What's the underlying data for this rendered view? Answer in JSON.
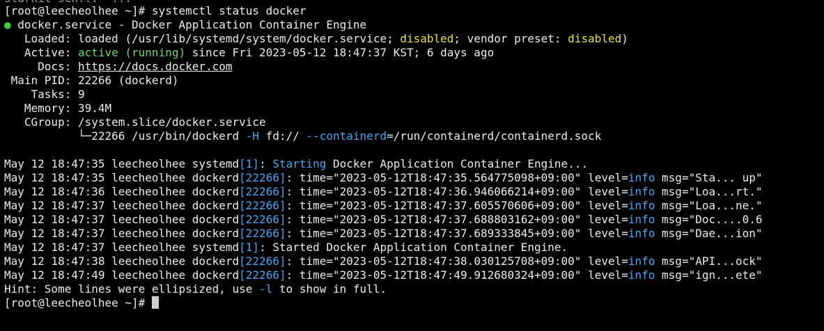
{
  "top_partial": "slarkit-sch...  ...",
  "prompt": "[root@leecheolhee ~]# ",
  "command": "systemctl status docker",
  "service": {
    "dot": "●",
    "name_line": " docker.service - Docker Application Container Engine",
    "loaded_label": "   Loaded: ",
    "loaded_value": "loaded (/usr/lib/systemd/system/docker.service; ",
    "loaded_disabled": "disabled",
    "loaded_mid": "; vendor preset: ",
    "loaded_preset": "disabled",
    "loaded_end": ")",
    "active_label": "   Active: ",
    "active_state": "active (running)",
    "active_since": " since Fri 2023-05-12 18:47:37 KST; 6 days ago",
    "docs_label": "     Docs: ",
    "docs_url": "https://docs.docker.com",
    "pid_line": " Main PID: 22266 (dockerd)",
    "tasks_line": "    Tasks: 9",
    "memory_line": "   Memory: 39.4M",
    "cgroup_line": "   CGroup: /system.slice/docker.service",
    "cgroup_tree_prefix": "           └─22266 /usr/bin/dockerd ",
    "cgroup_flag_h": "-H",
    "cgroup_mid": " fd:// ",
    "cgroup_flag_containerd": "--containerd",
    "cgroup_end": "=/run/containerd/containerd.sock"
  },
  "logs": [
    {
      "prefix": "May 12 18:47:35 leecheolhee systemd",
      "pid": "[1]",
      "sep": ": ",
      "mode": "start",
      "text_blue": "Starting",
      "text_rest": " Docker Application Container Engine..."
    },
    {
      "prefix": "May 12 18:47:35 leecheolhee dockerd",
      "pid": "[22266]",
      "sep": ": ",
      "mode": "dockerd",
      "time": "time=\"2023-05-12T18:47:35.564775098+09:00\" ",
      "level_key": "level=",
      "level_val": "info",
      "msg": " msg=\"Sta... up\""
    },
    {
      "prefix": "May 12 18:47:36 leecheolhee dockerd",
      "pid": "[22266]",
      "sep": ": ",
      "mode": "dockerd",
      "time": "time=\"2023-05-12T18:47:36.946066214+09:00\" ",
      "level_key": "level=",
      "level_val": "info",
      "msg": " msg=\"Loa...rt.\""
    },
    {
      "prefix": "May 12 18:47:37 leecheolhee dockerd",
      "pid": "[22266]",
      "sep": ": ",
      "mode": "dockerd",
      "time": "time=\"2023-05-12T18:47:37.605570606+09:00\" ",
      "level_key": "level=",
      "level_val": "info",
      "msg": " msg=\"Loa...ne.\""
    },
    {
      "prefix": "May 12 18:47:37 leecheolhee dockerd",
      "pid": "[22266]",
      "sep": ": ",
      "mode": "dockerd",
      "time": "time=\"2023-05-12T18:47:37.688803162+09:00\" ",
      "level_key": "level=",
      "level_val": "info",
      "msg": " msg=\"Doc....0.6"
    },
    {
      "prefix": "May 12 18:47:37 leecheolhee dockerd",
      "pid": "[22266]",
      "sep": ": ",
      "mode": "dockerd",
      "time": "time=\"2023-05-12T18:47:37.689333845+09:00\" ",
      "level_key": "level=",
      "level_val": "info",
      "msg": " msg=\"Dae...ion\""
    },
    {
      "prefix": "May 12 18:47:37 leecheolhee systemd",
      "pid": "[1]",
      "sep": ": ",
      "mode": "plain",
      "text_rest": "Started Docker Application Container Engine."
    },
    {
      "prefix": "May 12 18:47:38 leecheolhee dockerd",
      "pid": "[22266]",
      "sep": ": ",
      "mode": "dockerd",
      "time": "time=\"2023-05-12T18:47:38.030125708+09:00\" ",
      "level_key": "level=",
      "level_val": "info",
      "msg": " msg=\"API...ock\""
    },
    {
      "prefix": "May 12 18:47:49 leecheolhee dockerd",
      "pid": "[22266]",
      "sep": ": ",
      "mode": "dockerd",
      "time": "time=\"2023-05-12T18:47:49.912680324+09:00\" ",
      "level_key": "level=",
      "level_val": "info",
      "msg": " msg=\"ign...ete\""
    }
  ],
  "hint": {
    "before": "Hint: Some lines were ellipsized, use ",
    "flag": "-l",
    "after": " to show in full."
  },
  "final_prompt": "[root@leecheolhee ~]# "
}
